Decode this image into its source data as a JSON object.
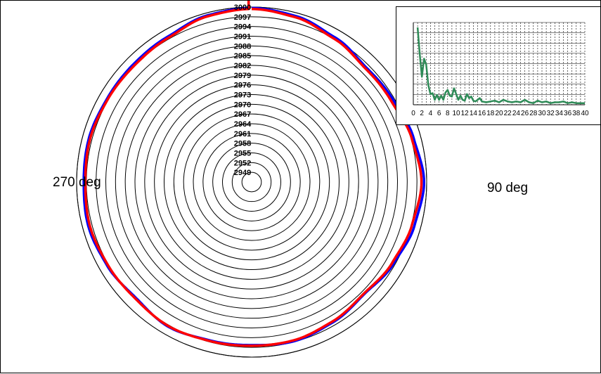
{
  "chart_data": [
    {
      "type": "polar-line",
      "radial_ticks": [
        "3000",
        "2997",
        "2994",
        "2991",
        "2988",
        "2985",
        "2982",
        "2979",
        "2976",
        "2973",
        "2970",
        "2967",
        "2964",
        "2961",
        "2958",
        "2955",
        "2952",
        "2949"
      ],
      "rlim": [
        2946,
        3000
      ],
      "angle_labels": {
        "left": "270 deg",
        "right": "90 deg"
      },
      "series": [
        {
          "color": "#0000ff",
          "theta_deg": [
            0,
            15,
            30,
            45,
            60,
            75,
            90,
            105,
            120,
            135,
            150,
            165,
            180,
            195,
            210,
            225,
            240,
            255,
            270,
            285,
            300,
            315,
            330,
            345
          ],
          "r": [
            2999.7,
            2999.0,
            2997.5,
            2996.0,
            2996.5,
            2997.8,
            2999.2,
            2998.0,
            2996.5,
            2995.0,
            2996.0,
            2996.8,
            2996.3,
            2996.5,
            2997.5,
            2996.5,
            2997.5,
            2998.2,
            2997.8,
            2998.0,
            2997.5,
            2997.5,
            2997.8,
            2999.2
          ]
        },
        {
          "color": "#ff0000",
          "theta_deg": [
            0,
            15,
            30,
            45,
            60,
            75,
            90,
            105,
            120,
            135,
            150,
            165,
            180,
            195,
            210,
            225,
            240,
            255,
            270,
            285,
            300,
            315,
            330,
            345
          ],
          "r": [
            2999.4,
            2998.6,
            2997.0,
            2995.6,
            2995.8,
            2997.2,
            2998.4,
            2997.2,
            2996.0,
            2994.8,
            2995.7,
            2996.5,
            2996.5,
            2996.7,
            2997.3,
            2996.8,
            2997.2,
            2997.7,
            2997.3,
            2997.6,
            2997.2,
            2997.0,
            2997.4,
            2998.9
          ]
        }
      ]
    },
    {
      "type": "line",
      "x_ticks": [
        "0",
        "2",
        "4",
        "6",
        "8",
        "10",
        "12",
        "14",
        "16",
        "18",
        "20",
        "22",
        "24",
        "26",
        "28",
        "30",
        "32",
        "34",
        "36",
        "38",
        "40"
      ],
      "xlim": [
        0,
        40
      ],
      "ylim": [
        0,
        1
      ],
      "grid": true,
      "series": [
        {
          "color": "#2e8b57",
          "x": [
            1,
            1.5,
            2,
            2.5,
            3,
            3.5,
            4,
            4.5,
            5,
            5.5,
            6,
            6.5,
            7,
            7.5,
            8,
            8.5,
            9,
            9.5,
            10,
            10.5,
            11,
            11.5,
            12,
            12.5,
            13,
            13.5,
            14,
            14.5,
            15,
            15.5,
            16,
            17,
            18,
            19,
            20,
            21,
            22,
            23,
            24,
            25,
            26,
            27,
            28,
            29,
            30,
            31,
            32,
            33,
            34,
            35,
            36,
            37,
            38,
            39,
            40
          ],
          "y": [
            0.94,
            0.62,
            0.34,
            0.56,
            0.49,
            0.24,
            0.13,
            0.14,
            0.06,
            0.12,
            0.06,
            0.11,
            0.06,
            0.15,
            0.18,
            0.11,
            0.1,
            0.2,
            0.13,
            0.06,
            0.11,
            0.06,
            0.05,
            0.13,
            0.08,
            0.1,
            0.05,
            0.04,
            0.06,
            0.08,
            0.04,
            0.03,
            0.04,
            0.05,
            0.03,
            0.06,
            0.04,
            0.03,
            0.04,
            0.03,
            0.06,
            0.03,
            0.02,
            0.05,
            0.03,
            0.04,
            0.02,
            0.03,
            0.03,
            0.04,
            0.02,
            0.03,
            0.02,
            0.02,
            0.02
          ]
        }
      ]
    }
  ]
}
